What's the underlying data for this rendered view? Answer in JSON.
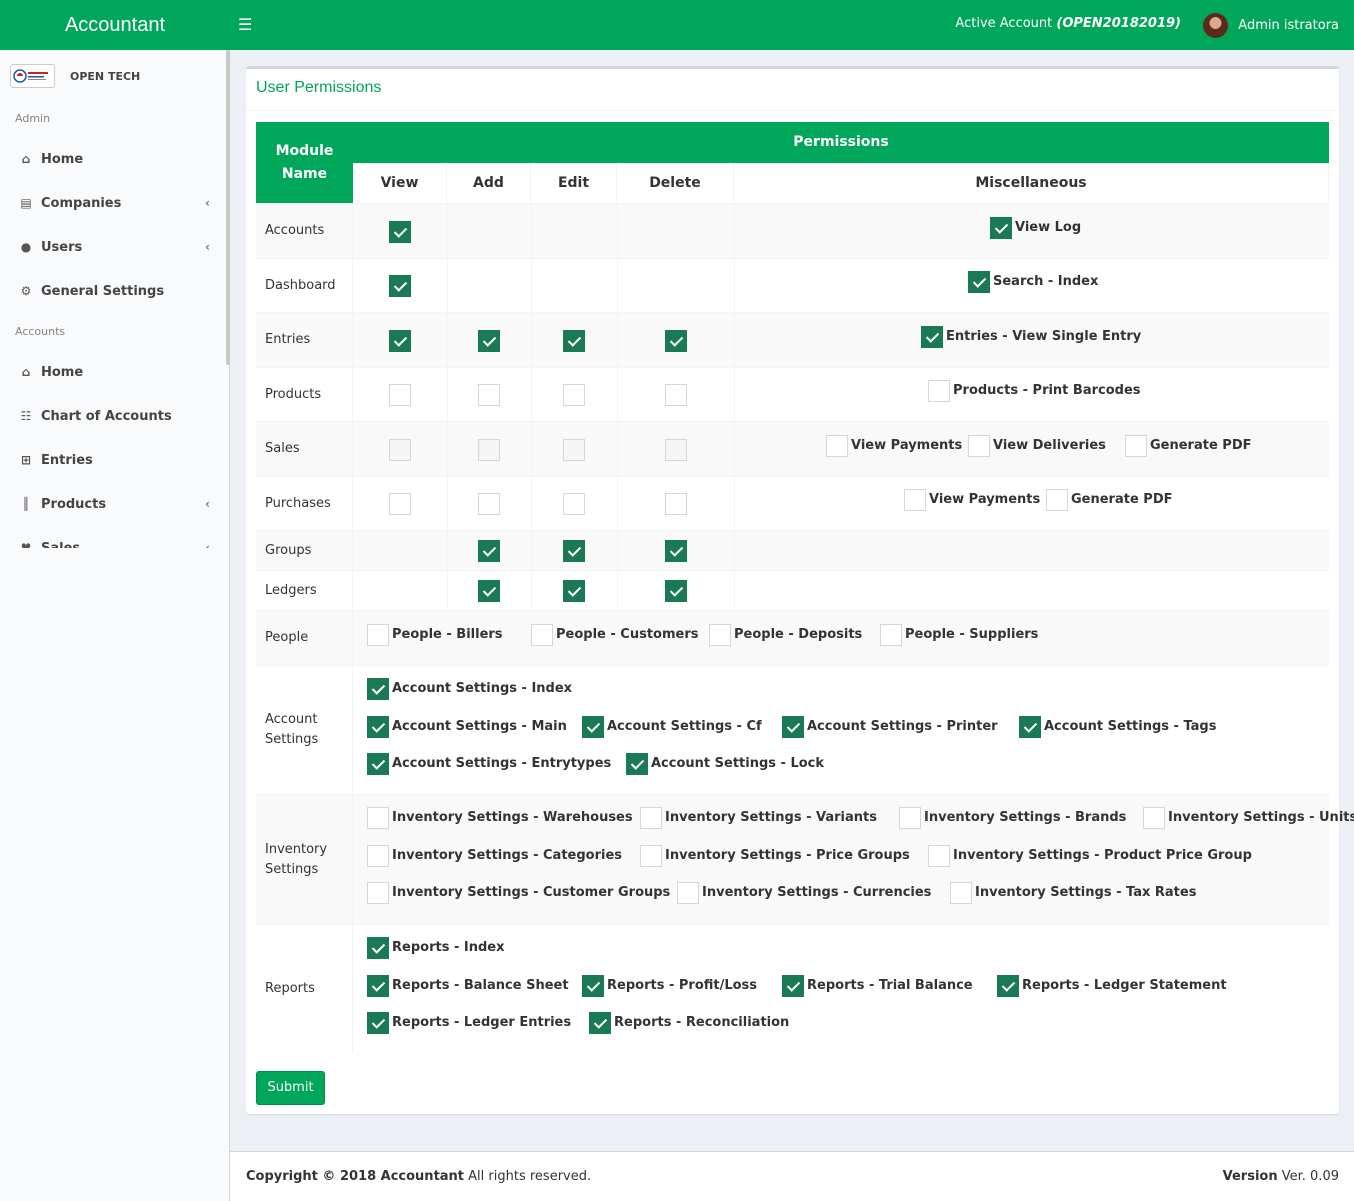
{
  "header": {
    "brand": "Accountant",
    "active_account_label": "Active Account",
    "active_account_code": "(OPEN20182019)",
    "username": "Admin istratora"
  },
  "sidebar": {
    "logo_text": "OPEN TECH",
    "sections": [
      {
        "title": "Admin",
        "items": [
          {
            "label": "Home",
            "icon": "home-icon"
          },
          {
            "label": "Companies",
            "icon": "address-book-icon",
            "has_submenu": true
          },
          {
            "label": "Users",
            "icon": "users-icon",
            "has_submenu": true
          },
          {
            "label": "General Settings",
            "icon": "gears-icon"
          }
        ]
      },
      {
        "title": "Accounts",
        "items": [
          {
            "label": "Home",
            "icon": "home-icon"
          },
          {
            "label": "Chart of Accounts",
            "icon": "sitemap-icon"
          },
          {
            "label": "Entries",
            "icon": "plus-square-icon"
          },
          {
            "label": "Products",
            "icon": "barcode-icon",
            "has_submenu": true
          },
          {
            "label": "Sales",
            "icon": "heart-icon",
            "has_submenu": true
          }
        ]
      }
    ]
  },
  "page": {
    "title": "User Permissions"
  },
  "table": {
    "module_header": "Module Name",
    "permissions_header": "Permissions",
    "columns": [
      "View",
      "Add",
      "Edit",
      "Delete",
      "Miscellaneous"
    ],
    "rows": [
      {
        "module": "Accounts",
        "view": true,
        "misc": [
          {
            "label": "View Log",
            "checked": true
          }
        ]
      },
      {
        "module": "Dashboard",
        "view": true,
        "misc": [
          {
            "label": "Search - Index",
            "checked": true
          }
        ]
      },
      {
        "module": "Entries",
        "view": true,
        "add": true,
        "edit": true,
        "delete": true,
        "misc": [
          {
            "label": "Entries - View Single Entry",
            "checked": true
          }
        ]
      },
      {
        "module": "Products",
        "view": false,
        "add": false,
        "edit": false,
        "delete": false,
        "misc": [
          {
            "label": "Products - Print Barcodes",
            "checked": false
          }
        ]
      },
      {
        "module": "Sales",
        "view": false,
        "add": false,
        "edit": false,
        "delete": false,
        "misc": [
          {
            "label": "View Payments",
            "checked": false
          },
          {
            "label": "View Deliveries",
            "checked": false
          },
          {
            "label": "Generate PDF",
            "checked": false
          }
        ]
      },
      {
        "module": "Purchases",
        "view": false,
        "add": false,
        "edit": false,
        "delete": false,
        "misc": [
          {
            "label": "View Payments",
            "checked": false
          },
          {
            "label": "Generate PDF",
            "checked": false
          }
        ]
      },
      {
        "module": "Groups",
        "add": true,
        "edit": true,
        "delete": true
      },
      {
        "module": "Ledgers",
        "add": true,
        "edit": true,
        "delete": true
      }
    ],
    "wide_rows": [
      {
        "module": "People",
        "lines": [
          [
            {
              "label": "People - Billers",
              "checked": false
            },
            {
              "label": "People - Customers",
              "checked": false
            },
            {
              "label": "People - Deposits",
              "checked": false
            },
            {
              "label": "People - Suppliers",
              "checked": false
            }
          ]
        ]
      },
      {
        "module": "Account Settings",
        "lines": [
          [
            {
              "label": "Account Settings - Index",
              "checked": true
            }
          ],
          [
            {
              "label": "Account Settings - Main",
              "checked": true
            },
            {
              "label": "Account Settings - Cf",
              "checked": true
            },
            {
              "label": "Account Settings - Printer",
              "checked": true
            },
            {
              "label": "Account Settings - Tags",
              "checked": true
            }
          ],
          [
            {
              "label": "Account Settings - Entrytypes",
              "checked": true
            },
            {
              "label": "Account Settings - Lock",
              "checked": true
            }
          ]
        ]
      },
      {
        "module": "Inventory Settings",
        "lines": [
          [
            {
              "label": "Inventory Settings - Warehouses",
              "checked": false
            },
            {
              "label": "Inventory Settings - Variants",
              "checked": false
            },
            {
              "label": "Inventory Settings - Brands",
              "checked": false
            },
            {
              "label": "Inventory Settings - Units",
              "checked": false
            }
          ],
          [
            {
              "label": "Inventory Settings - Categories",
              "checked": false
            },
            {
              "label": "Inventory Settings - Price Groups",
              "checked": false
            },
            {
              "label": "Inventory Settings - Product Price Group",
              "checked": false
            }
          ],
          [
            {
              "label": "Inventory Settings - Customer Groups",
              "checked": false
            },
            {
              "label": "Inventory Settings - Currencies",
              "checked": false
            },
            {
              "label": "Inventory Settings - Tax Rates",
              "checked": false
            }
          ]
        ]
      },
      {
        "module": "Reports",
        "lines": [
          [
            {
              "label": "Reports - Index",
              "checked": true
            }
          ],
          [
            {
              "label": "Reports - Balance Sheet",
              "checked": true
            },
            {
              "label": "Reports - Profit/Loss",
              "checked": true
            },
            {
              "label": "Reports - Trial Balance",
              "checked": true
            },
            {
              "label": "Reports - Ledger Statement",
              "checked": true
            }
          ],
          [
            {
              "label": "Reports - Ledger Entries",
              "checked": true
            },
            {
              "label": "Reports - Reconciliation",
              "checked": true
            }
          ]
        ]
      }
    ]
  },
  "submit_label": "Submit",
  "footer": {
    "copyright_bold": "Copyright © 2018 Accountant",
    "copyright_rest": " All rights reserved.",
    "version_bold": "Version",
    "version_rest": " Ver. 0.09"
  }
}
